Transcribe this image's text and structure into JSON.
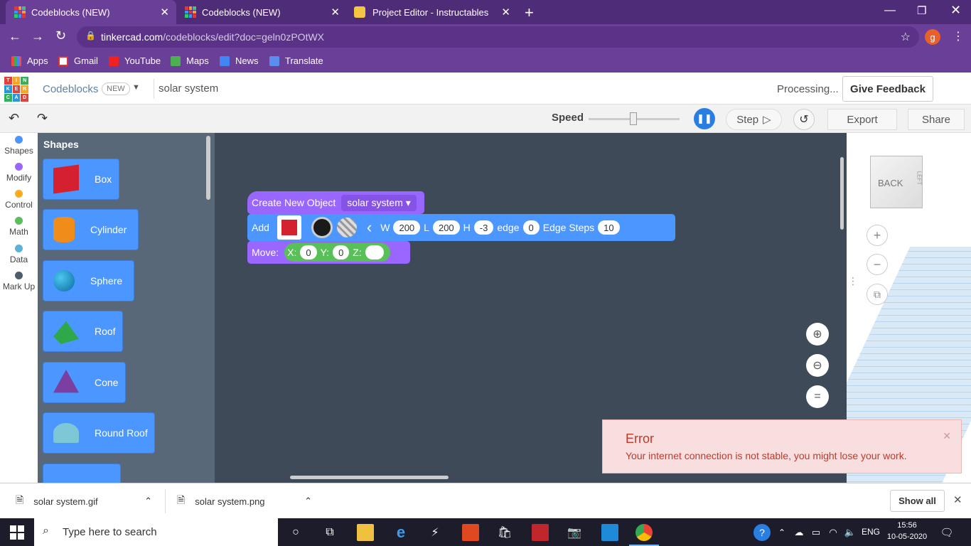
{
  "browser": {
    "tabs": [
      {
        "title": "Codeblocks (NEW)"
      },
      {
        "title": "Codeblocks (NEW)"
      },
      {
        "title": "Project Editor - Instructables"
      }
    ],
    "url_host": "tinkercad.com",
    "url_path": "/codeblocks/edit?doc=geln0zPOtWX",
    "profile_initial": "g",
    "bookmarks": [
      "Apps",
      "Gmail",
      "YouTube",
      "Maps",
      "News",
      "Translate"
    ]
  },
  "app": {
    "logo_letters": [
      "T",
      "I",
      "N",
      "K",
      "E",
      "R",
      "C",
      "A",
      "D"
    ],
    "product": "Codeblocks",
    "badge": "NEW",
    "doc_title": "solar system",
    "status": "Processing...",
    "feedback_label": "Give Feedback"
  },
  "toolbar": {
    "speed_label": "Speed",
    "speed_level": 0.5,
    "step_label": "Step",
    "export_label": "Export",
    "share_label": "Share"
  },
  "categories": [
    {
      "label": "Shapes",
      "color": "#4c97ff"
    },
    {
      "label": "Modify",
      "color": "#9966ff"
    },
    {
      "label": "Control",
      "color": "#ffab19"
    },
    {
      "label": "Math",
      "color": "#59c059"
    },
    {
      "label": "Data",
      "color": "#5cb1d6"
    },
    {
      "label": "Mark Up",
      "color": "#4d5d6e"
    }
  ],
  "palette": {
    "title": "Shapes",
    "items": [
      "Box",
      "Cylinder",
      "Sphere",
      "Roof",
      "Cone",
      "Round Roof"
    ]
  },
  "workspace": {
    "create_label": "Create New Object",
    "create_value": "solar system",
    "add_label": "Add",
    "w_label": "W",
    "w_value": "200",
    "l_label": "L",
    "l_value": "200",
    "h_label": "H",
    "h_value": "-3",
    "edge_label": "edge",
    "edge_value": "0",
    "edge_steps_label": "Edge Steps",
    "edge_steps_value": "10",
    "move_label": "Move:",
    "x_label": "X:",
    "x_value": "0",
    "y_label": "Y:",
    "y_value": "0",
    "z_label": "Z:",
    "z_value": ""
  },
  "viewcube": {
    "face_front": "BACK",
    "face_side": "LEFT"
  },
  "error": {
    "title": "Error",
    "message": "Your internet connection is not stable, you might lose your work."
  },
  "downloads": {
    "files": [
      "solar system.gif",
      "solar system.png"
    ],
    "show_all": "Show all"
  },
  "taskbar": {
    "search_placeholder": "Type here to search",
    "lang": "ENG",
    "time": "15:56",
    "date": "10-05-2020"
  }
}
